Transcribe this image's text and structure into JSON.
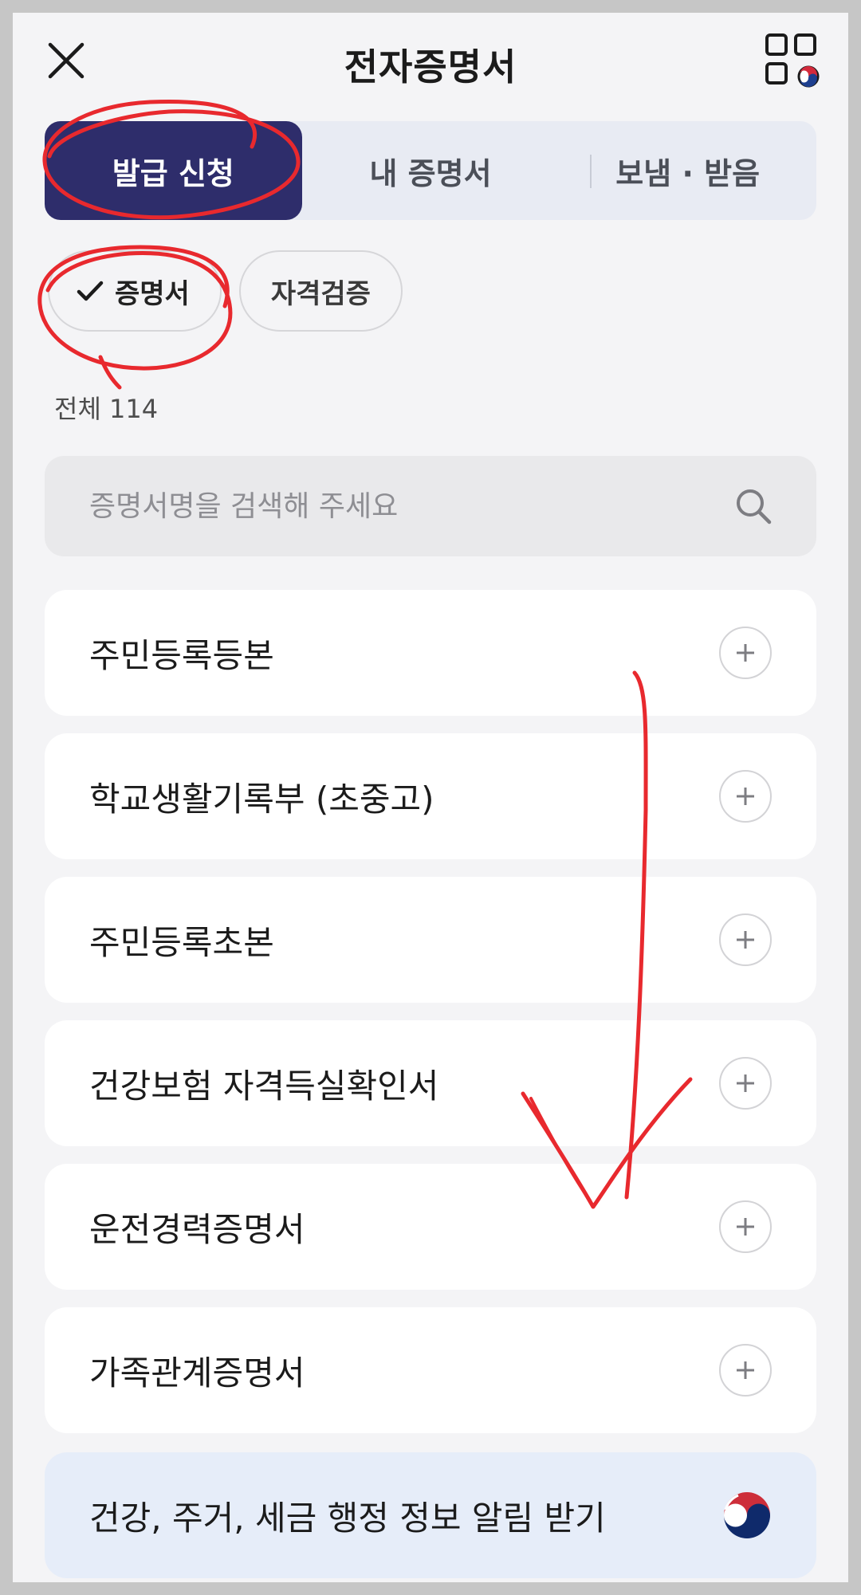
{
  "header": {
    "title": "전자증명서",
    "close_icon": "close-icon",
    "menu_icon": "grid-menu-icon"
  },
  "tabs": [
    {
      "label": "발급 신청",
      "active": true
    },
    {
      "label": "내 증명서",
      "active": false
    },
    {
      "label": "보냄 · 받음",
      "active": false
    }
  ],
  "chips": [
    {
      "label": "증명서",
      "selected": true,
      "icon": "check-icon"
    },
    {
      "label": "자격검증",
      "selected": false
    }
  ],
  "count_text": "전체 114",
  "search": {
    "placeholder": "증명서명을 검색해 주세요",
    "value": "",
    "icon": "search-icon"
  },
  "items": [
    {
      "label": "주민등록등본"
    },
    {
      "label": "학교생활기록부 (초중고)"
    },
    {
      "label": "주민등록초본"
    },
    {
      "label": "건강보험 자격득실확인서"
    },
    {
      "label": "운전경력증명서"
    },
    {
      "label": "가족관계증명서"
    }
  ],
  "notice": {
    "label": "건강, 주거, 세금 행정 정보 알림 받기",
    "icon": "taegeuk-icon"
  },
  "colors": {
    "active_tab": "#2e2d6b",
    "tabs_bg": "#e8ebf3",
    "notice_bg": "#e6edf9",
    "annotation": "#e8292e"
  }
}
